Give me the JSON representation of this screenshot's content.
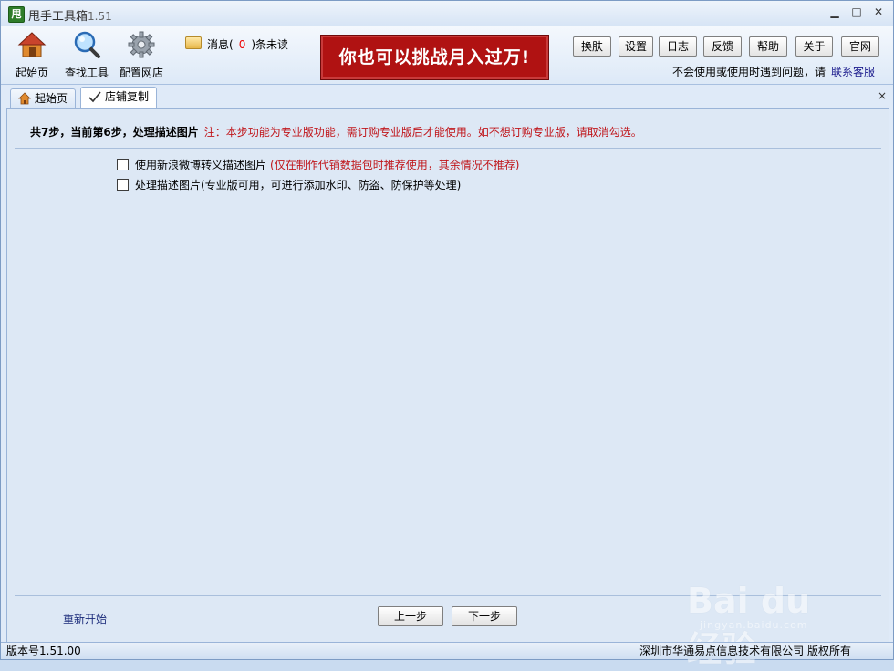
{
  "window": {
    "title": "甩手工具箱",
    "version": "1.51",
    "controls": {
      "minimize": "▁",
      "maximize": "□",
      "close": "✕"
    }
  },
  "toolbar": {
    "home_label": "起始页",
    "find_tools_label": "查找工具",
    "config_shop_label": "配置网店",
    "messages_prefix": "消息(",
    "messages_count": "0",
    "messages_suffix": ")条未读",
    "banner_text": "你也可以挑战月入过万!",
    "buttons": [
      "换肤",
      "设置",
      "日志",
      "反馈",
      "帮助",
      "关于",
      "官网"
    ],
    "help_note": "不会使用或使用时遇到问题，请",
    "help_link": "联系客服"
  },
  "tabs": [
    {
      "label": "起始页",
      "icon": "home-icon",
      "active": false
    },
    {
      "label": "店铺复制",
      "icon": "check-pen-icon",
      "active": true
    }
  ],
  "tab_close": "×",
  "content": {
    "step_title": "共7步，当前第6步，处理描述图片",
    "step_note": "注：本步功能为专业版功能，需订购专业版后才能使用。如不想订购专业版，请取消勾选。",
    "options": [
      {
        "label": "使用新浪微博转义描述图片",
        "hint": "(仅在制作代销数据包时推荐使用，其余情况不推荐)",
        "checked": false
      },
      {
        "label": "处理描述图片(专业版可用，可进行添加水印、防盗、防保护等处理)",
        "hint": "",
        "checked": false
      }
    ],
    "restart_label": "重新开始",
    "prev_label": "上一步",
    "next_label": "下一步"
  },
  "statusbar": {
    "version": "版本号1.51.00",
    "copyright": "深圳市华通易点信息技术有限公司 版权所有"
  },
  "watermark": {
    "brand": "Bai du 经验",
    "url": "jingyan.baidu.com"
  },
  "colors": {
    "accent_red": "#c0161b",
    "banner_red": "#b01212",
    "panel_blue": "#dde8f5",
    "link_blue": "#1a1a8c"
  }
}
